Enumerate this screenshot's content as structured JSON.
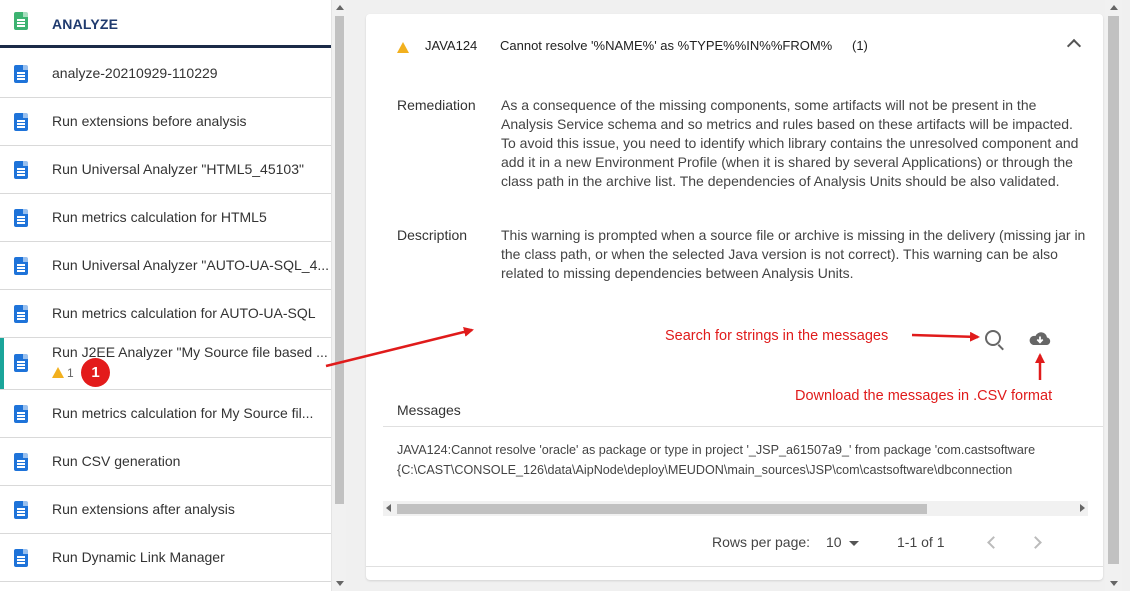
{
  "sidebar": {
    "header": "ANALYZE",
    "items": [
      {
        "label": "analyze-20210929-110229"
      },
      {
        "label": "Run extensions before analysis"
      },
      {
        "label": "Run Universal Analyzer \"HTML5_45103\""
      },
      {
        "label": "Run metrics calculation for HTML5"
      },
      {
        "label": "Run Universal Analyzer \"AUTO-UA-SQL_4..."
      },
      {
        "label": "Run metrics calculation for AUTO-UA-SQL"
      },
      {
        "label": "Run J2EE Analyzer \"My Source file based ...",
        "warning_count": "1"
      },
      {
        "label": "Run metrics calculation for My Source fil..."
      },
      {
        "label": "Run CSV generation"
      },
      {
        "label": "Run extensions after analysis"
      },
      {
        "label": "Run Dynamic Link Manager"
      }
    ],
    "step_badge": "1"
  },
  "issue": {
    "code": "JAVA124",
    "title": "Cannot resolve '%NAME%' as %TYPE%%IN%%FROM%",
    "count": "(1)",
    "remediation_label": "Remediation",
    "remediation_text": "As a consequence of the missing components, some artifacts will not be present in the Analysis Service schema and so metrics and rules based on these artifacts will be impacted. To avoid this issue, you need to identify which library contains the unresolved component and add it in a new Environment Profile (when it is shared by several Applications) or through the class path in the archive list. The dependencies of Analysis Units should be also validated.",
    "description_label": "Description",
    "description_text": "This warning is prompted when a source file or archive is missing in the delivery (missing jar in the class path, or when the selected Java version is not correct). This warning can be also related to missing dependencies between Analysis Units."
  },
  "annotations": {
    "search": "Search for strings in the messages",
    "download": "Download the messages in .CSV format"
  },
  "messages": {
    "label": "Messages",
    "line1": "JAVA124:Cannot resolve 'oracle' as package or type in project '_JSP_a61507a9_' from package 'com.castsoftware",
    "line2": "{C:\\CAST\\CONSOLE_126\\data\\AipNode\\deploy\\MEUDON\\main_sources\\JSP\\com\\castsoftware\\dbconnection"
  },
  "pagination": {
    "rows_label": "Rows per page:",
    "rows_value": "10",
    "range": "1-1 of 1"
  },
  "colors": {
    "accent_teal": "#1aa59a",
    "doc_blue": "#1e73d9",
    "doc_green": "#3cb371",
    "annotation_red": "#e01b1b",
    "warning_yellow": "#f2b01e"
  }
}
